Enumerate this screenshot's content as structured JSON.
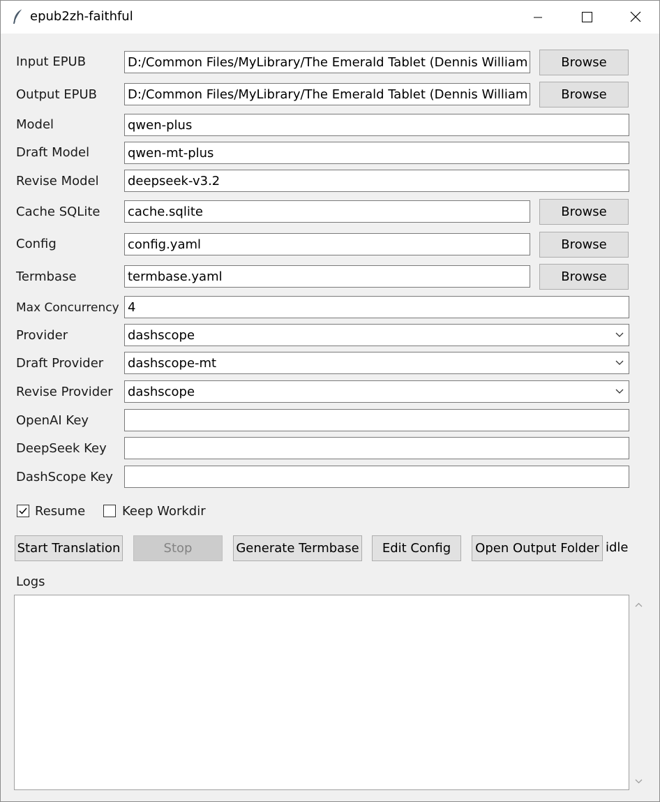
{
  "window": {
    "title": "epub2zh-faithful",
    "title_icon": "feather-icon",
    "controls": [
      "minimize-icon",
      "maximize-icon",
      "close-icon"
    ]
  },
  "form": {
    "input_epub": {
      "label": "Input EPUB",
      "value": "D:/Common Files/MyLibrary/The Emerald Tablet (Dennis William H",
      "button": "Browse"
    },
    "output_epub": {
      "label": "Output EPUB",
      "value": "D:/Common Files/MyLibrary/The Emerald Tablet (Dennis William H",
      "button": "Browse"
    },
    "model": {
      "label": "Model",
      "value": "qwen-plus"
    },
    "draft_model": {
      "label": "Draft Model",
      "value": "qwen-mt-plus"
    },
    "revise_model": {
      "label": "Revise Model",
      "value": "deepseek-v3.2"
    },
    "cache_sqlite": {
      "label": "Cache SQLite",
      "value": "cache.sqlite",
      "button": "Browse"
    },
    "config": {
      "label": "Config",
      "value": "config.yaml",
      "button": "Browse"
    },
    "termbase": {
      "label": "Termbase",
      "value": "termbase.yaml",
      "button": "Browse"
    },
    "max_concurrency": {
      "label": "Max Concurrency",
      "value": "4"
    },
    "provider": {
      "label": "Provider",
      "value": "dashscope"
    },
    "draft_provider": {
      "label": "Draft Provider",
      "value": "dashscope-mt"
    },
    "revise_provider": {
      "label": "Revise Provider",
      "value": "dashscope"
    },
    "openai_key": {
      "label": "OpenAI Key",
      "value": ""
    },
    "deepseek_key": {
      "label": "DeepSeek Key",
      "value": ""
    },
    "dashscope_key": {
      "label": "DashScope Key",
      "value": ""
    }
  },
  "options": {
    "resume": {
      "label": "Resume",
      "checked": true
    },
    "keep_workdir": {
      "label": "Keep Workdir",
      "checked": false
    }
  },
  "actions": {
    "start": "Start Translation",
    "stop": "Stop",
    "generate_termbase": "Generate Termbase",
    "edit_config": "Edit Config",
    "open_output_folder": "Open Output Folder",
    "status": "idle"
  },
  "logs": {
    "label": "Logs",
    "content": ""
  },
  "colors": {
    "window_bg": "#f0f0f0",
    "button_bg": "#e1e1e1",
    "button_disabled_bg": "#cccccc",
    "field_bg": "#ffffff"
  }
}
